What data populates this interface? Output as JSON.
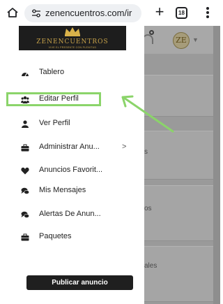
{
  "browser": {
    "url": "zenencuentros.com/ir",
    "tab_count": "18"
  },
  "logo": {
    "brand": "ZENENCUENTROS",
    "tagline": "VIVE EL PRESENTE CON PLENITUD"
  },
  "header": {
    "avatar_letters": "ZE"
  },
  "menu": {
    "items": [
      {
        "label": "Tablero",
        "icon": "dashboard-icon"
      },
      {
        "label": "Editar Perfil",
        "icon": "users-icon"
      },
      {
        "label": "Ver Perfil",
        "icon": "user-icon"
      },
      {
        "label": "Administrar Anu...",
        "icon": "briefcase-icon",
        "has_submenu": true,
        "chevron": ">"
      },
      {
        "label": "Anuncios Favorit...",
        "icon": "heart-icon"
      },
      {
        "label": "Mis Mensajes",
        "icon": "chat-icon"
      },
      {
        "label": "Alertas De Anun...",
        "icon": "chat-icon"
      },
      {
        "label": "Paquetes",
        "icon": "briefcase-icon"
      }
    ],
    "publish_label": "Publicar anuncio"
  },
  "background_snippets": {
    "s1": "s",
    "s2": "os",
    "s3": "ales"
  },
  "annotation": {
    "highlight_color": "#8bd46a",
    "highlighted_item": "Editar Perfil"
  }
}
